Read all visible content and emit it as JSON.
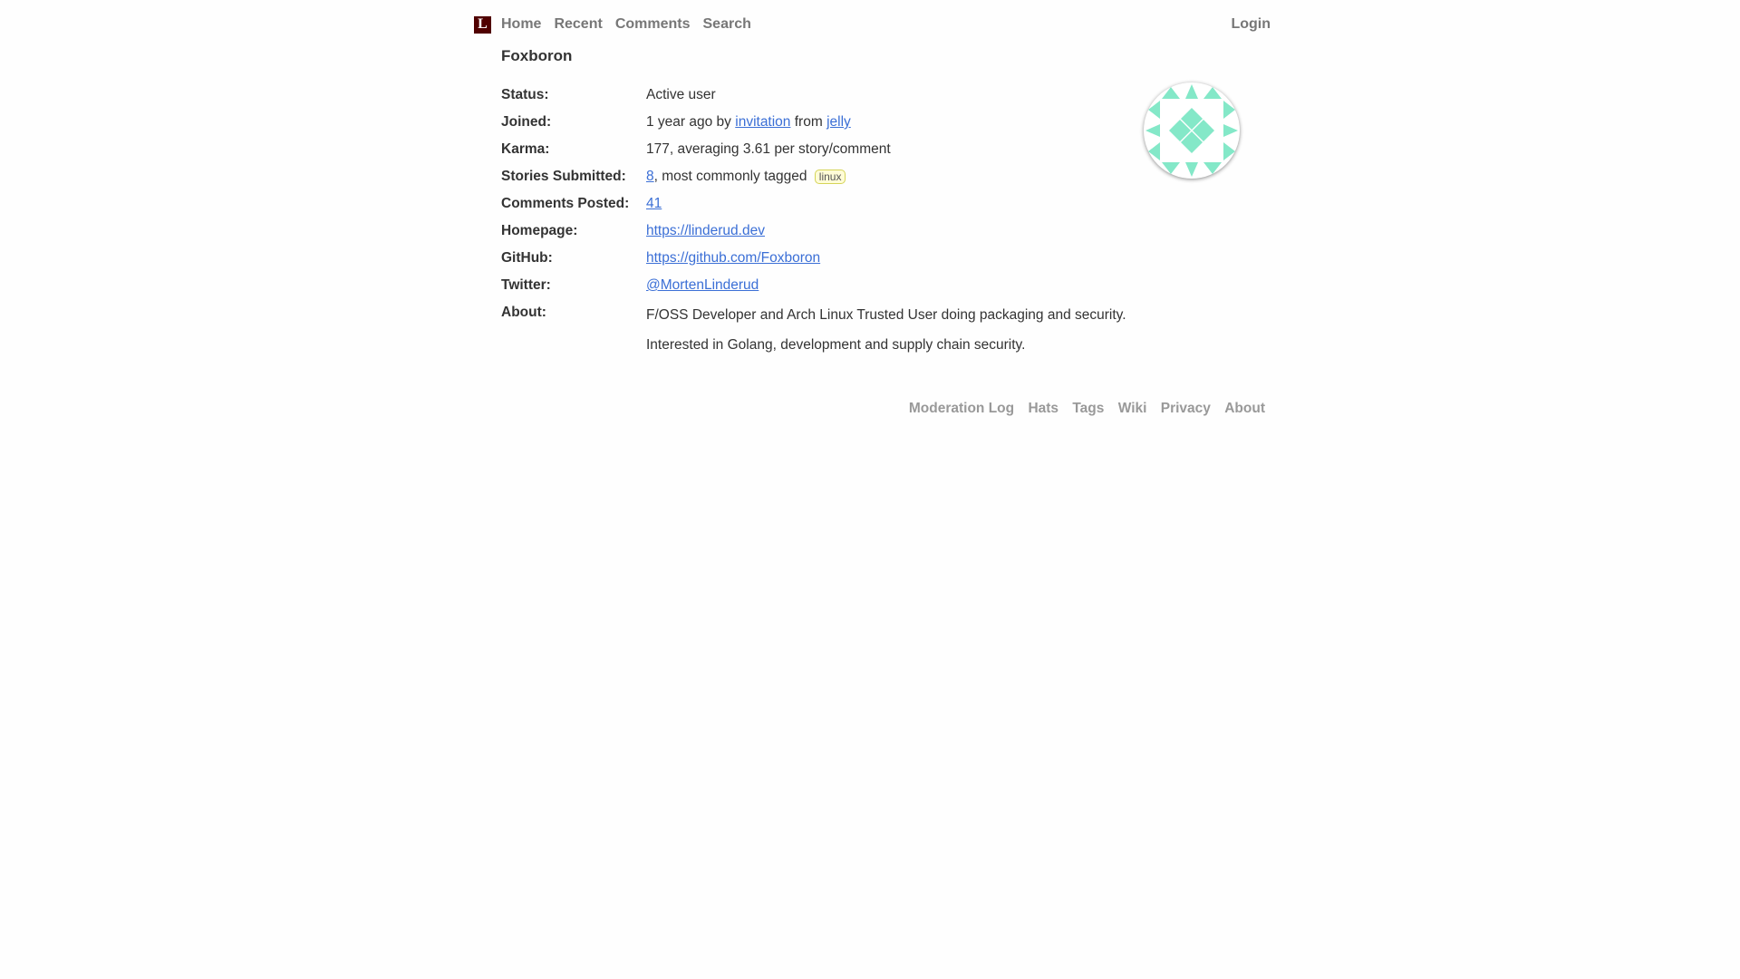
{
  "nav": {
    "logo": "L",
    "items": [
      "Home",
      "Recent",
      "Comments",
      "Search"
    ],
    "login": "Login"
  },
  "user": {
    "name": "Foxboron",
    "status_label": "Status:",
    "status": "Active user",
    "joined_label": "Joined:",
    "joined_prefix": "1 year ago by",
    "joined_link": "invitation",
    "joined_from": "from",
    "joined_inviter": "jelly",
    "karma_label": "Karma:",
    "karma": "177, averaging 3.61 per story/comment",
    "stories_label": "Stories Submitted:",
    "stories_count": "8",
    "stories_text": ", most commonly tagged",
    "stories_tag": "linux",
    "comments_label": "Comments Posted:",
    "comments_count": "41",
    "homepage_label": "Homepage:",
    "homepage": "https://linderud.dev",
    "github_label": "GitHub:",
    "github": "https://github.com/Foxboron",
    "twitter_label": "Twitter:",
    "twitter": "@MortenLinderud",
    "about_label": "About:",
    "about": [
      "F/OSS Developer and Arch Linux Trusted User doing packaging and security.",
      "Interested in Golang, development and supply chain security."
    ],
    "avatar_color": "#84e8c8"
  },
  "footer": [
    "Moderation Log",
    "Hats",
    "Tags",
    "Wiki",
    "Privacy",
    "About"
  ]
}
